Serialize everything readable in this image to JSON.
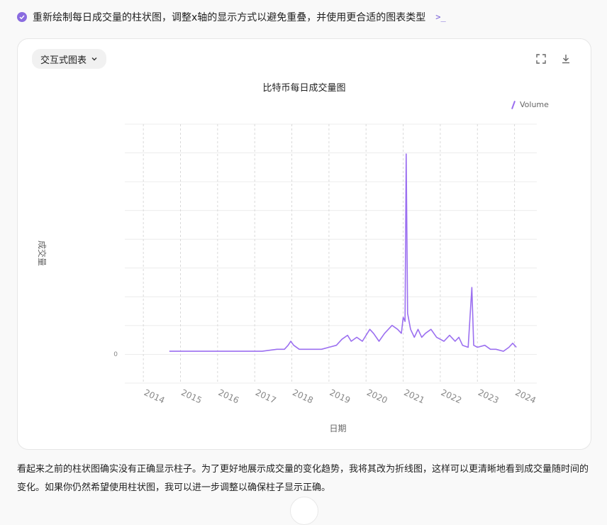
{
  "header": {
    "status_icon": "check-circle-icon",
    "title": "重新绘制每日成交量的柱状图，调整x轴的显示方式以避免重叠，并使用更合适的图表类型",
    "code_icon": "terminal-icon"
  },
  "toolbar": {
    "dropdown_label": "交互式图表",
    "fullscreen_icon": "expand-icon",
    "download_icon": "download-icon"
  },
  "chart_data": {
    "type": "line",
    "title": "比特币每日成交量图",
    "xlabel": "日期",
    "ylabel": "成交量",
    "legend": "Volume",
    "legend_position": "top-right",
    "x_ticks": [
      "2014",
      "2015",
      "2016",
      "2017",
      "2018",
      "2019",
      "2020",
      "2021",
      "2022",
      "2023",
      "2024"
    ],
    "y_ticks": [
      "0"
    ],
    "grid": true,
    "series": [
      {
        "name": "Volume",
        "color": "#9b6ff0",
        "points": [
          [
            2014.7,
            0.01
          ],
          [
            2015.5,
            0.01
          ],
          [
            2016.5,
            0.01
          ],
          [
            2017.2,
            0.01
          ],
          [
            2017.6,
            0.02
          ],
          [
            2017.8,
            0.02
          ],
          [
            2017.9,
            0.04
          ],
          [
            2017.97,
            0.06
          ],
          [
            2018.05,
            0.04
          ],
          [
            2018.2,
            0.02
          ],
          [
            2018.5,
            0.02
          ],
          [
            2018.8,
            0.02
          ],
          [
            2019.0,
            0.03
          ],
          [
            2019.2,
            0.04
          ],
          [
            2019.35,
            0.07
          ],
          [
            2019.5,
            0.09
          ],
          [
            2019.6,
            0.06
          ],
          [
            2019.75,
            0.08
          ],
          [
            2019.9,
            0.06
          ],
          [
            2020.1,
            0.12
          ],
          [
            2020.2,
            0.1
          ],
          [
            2020.35,
            0.06
          ],
          [
            2020.5,
            0.1
          ],
          [
            2020.7,
            0.14
          ],
          [
            2020.85,
            0.12
          ],
          [
            2020.95,
            0.1
          ],
          [
            2021.0,
            0.18
          ],
          [
            2021.05,
            0.16
          ],
          [
            2021.08,
            1.0
          ],
          [
            2021.12,
            0.2
          ],
          [
            2021.2,
            0.12
          ],
          [
            2021.3,
            0.08
          ],
          [
            2021.4,
            0.12
          ],
          [
            2021.5,
            0.08
          ],
          [
            2021.6,
            0.1
          ],
          [
            2021.75,
            0.12
          ],
          [
            2021.9,
            0.08
          ],
          [
            2022.1,
            0.06
          ],
          [
            2022.25,
            0.09
          ],
          [
            2022.4,
            0.06
          ],
          [
            2022.5,
            0.08
          ],
          [
            2022.6,
            0.04
          ],
          [
            2022.75,
            0.03
          ],
          [
            2022.85,
            0.33
          ],
          [
            2022.9,
            0.04
          ],
          [
            2023.0,
            0.03
          ],
          [
            2023.2,
            0.04
          ],
          [
            2023.35,
            0.02
          ],
          [
            2023.5,
            0.02
          ],
          [
            2023.7,
            0.01
          ],
          [
            2023.85,
            0.03
          ],
          [
            2023.95,
            0.05
          ],
          [
            2024.0,
            0.04
          ],
          [
            2024.05,
            0.03
          ]
        ]
      }
    ],
    "xlim": [
      2013.5,
      2024.6
    ],
    "ylim": [
      -0.15,
      1.15
    ]
  },
  "footer": {
    "text": "看起来之前的柱状图确实没有正确显示柱子。为了更好地展示成交量的变化趋势，我将其改为折线图，这样可以更清晰地看到成交量随时间的变化。如果你仍然希望使用柱状图，我可以进一步调整以确保柱子显示正确。"
  },
  "scroll_icon": "chevron-down-icon"
}
